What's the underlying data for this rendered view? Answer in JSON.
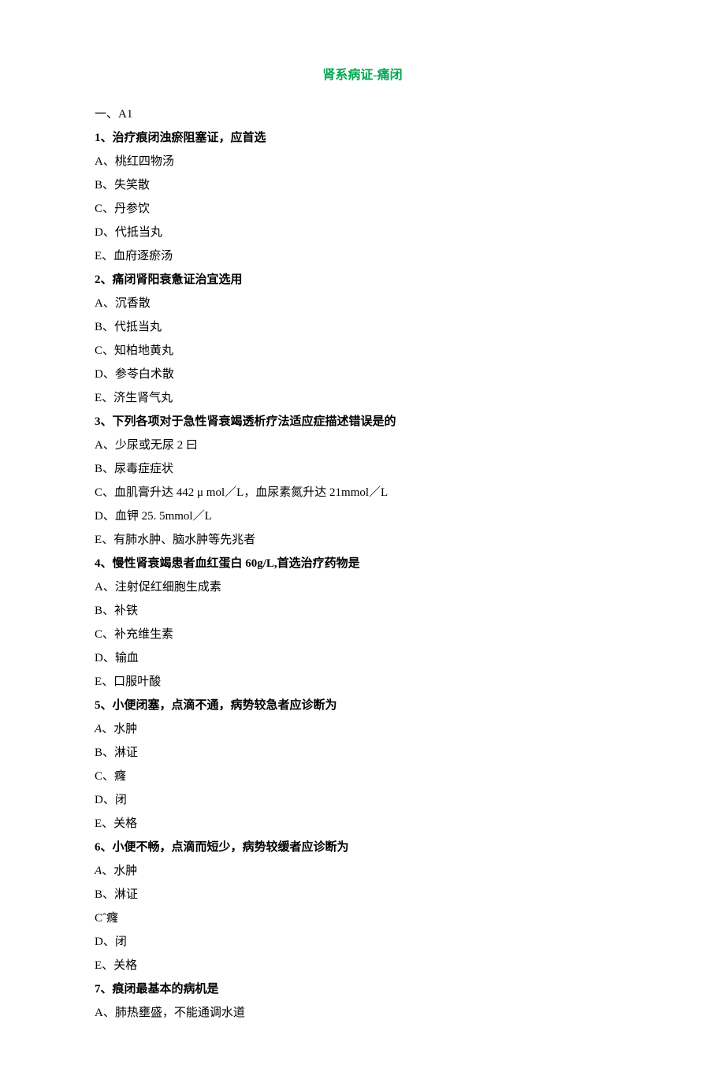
{
  "title": "肾系病证-痛闭",
  "section_label": "一、A1",
  "questions": [
    {
      "stem": "1、治疗痕闭浊瘀阻塞证，应首选",
      "options": [
        "A、桃红四物汤",
        "B、失笑散",
        "C、丹参饮",
        "D、代抵当丸",
        "E、血府逐瘀汤"
      ]
    },
    {
      "stem": "2、痛闭肾阳衰惫证治宜选用",
      "options": [
        "A、沉香散",
        "B、代抵当丸",
        "C、知柏地黄丸",
        "D、参苓白术散",
        "E、济生肾气丸"
      ]
    },
    {
      "stem": "3、下列各项对于急性肾衰竭透析疗法适应症描述错误是的",
      "options": [
        "A、少尿或无尿 2 曰",
        "B、尿毒症症状",
        "C、血肌膏升达 442 μ mol／L，血尿素氮升达 21mmol／L",
        "D、血钾 25. 5mmol／L",
        "E、有肺水肿、脑水肿等先兆者"
      ]
    },
    {
      "stem": "4、慢性肾衰竭患者血红蛋白 60g/L,首选治疗药物是",
      "options": [
        "A、注射促红细胞生成素",
        "B、补铁",
        "C、补充维生素",
        "D、输血",
        "E、口服叶酸"
      ]
    },
    {
      "stem": "5、小便闭塞，点滴不通，病势较急者应诊断为",
      "options": [],
      "la_option": {
        "prefix": "A",
        "sep": "、",
        "text": "水肿"
      },
      "more": [
        "B、淋证",
        "C、癃",
        "D、闭",
        "E、关格"
      ]
    },
    {
      "stem": "6、小便不畅，点滴而短少，病势较缓者应诊断为",
      "options": [],
      "la_option": {
        "prefix": "A",
        "sep": "、",
        "text": "水肿"
      },
      "more": [
        "B、淋证",
        "Cˆ癃",
        "D、闭",
        "E、关格"
      ]
    },
    {
      "stem": "7、痕闭最基本的病机是",
      "options": [
        "A、肺热壅盛，不能通调水道"
      ]
    }
  ]
}
